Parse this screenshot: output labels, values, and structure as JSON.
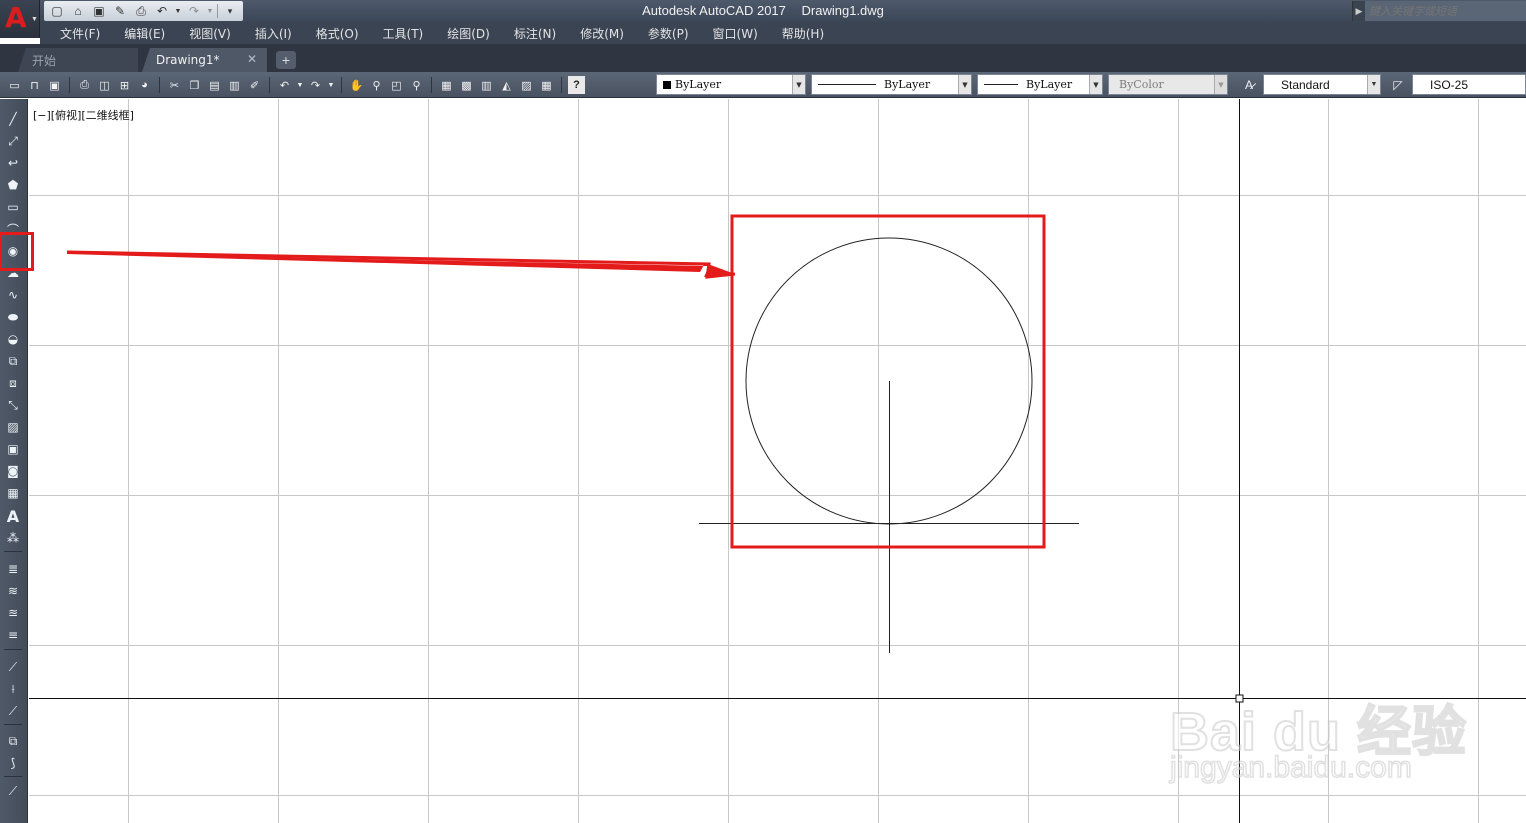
{
  "title_bar": {
    "app_name": "Autodesk AutoCAD 2017",
    "file_name": "Drawing1.dwg",
    "search_placeholder": "键入关键字或短语",
    "logo_letter": "A"
  },
  "menu": [
    "文件(F)",
    "编辑(E)",
    "视图(V)",
    "插入(I)",
    "格式(O)",
    "工具(T)",
    "绘图(D)",
    "标注(N)",
    "修改(M)",
    "参数(P)",
    "窗口(W)",
    "帮助(H)"
  ],
  "tabs": {
    "start_label": "开始",
    "drawing_label": "Drawing1*",
    "close_glyph": "✕",
    "add_glyph": "+"
  },
  "toolbar": {
    "color_value": "ByLayer",
    "linetype_value": "ByLayer",
    "lineweight_value": "ByLayer",
    "plotstyle_value": "ByColor",
    "text_style_value": "Standard",
    "dim_style_value": "ISO-25",
    "help_glyph": "?"
  },
  "left_toolbar": {
    "text_tool_glyph": "A"
  },
  "canvas": {
    "viewport_label": "[−][俯视][二维线框]"
  },
  "watermark": {
    "brand": "Bai du 经验",
    "url": "jingyan.baidu.com"
  },
  "colors": {
    "highlight": "#e31b1b",
    "accent_red": "#d81e1e",
    "grid": "#c8c8c8",
    "geometry": "#222222"
  }
}
